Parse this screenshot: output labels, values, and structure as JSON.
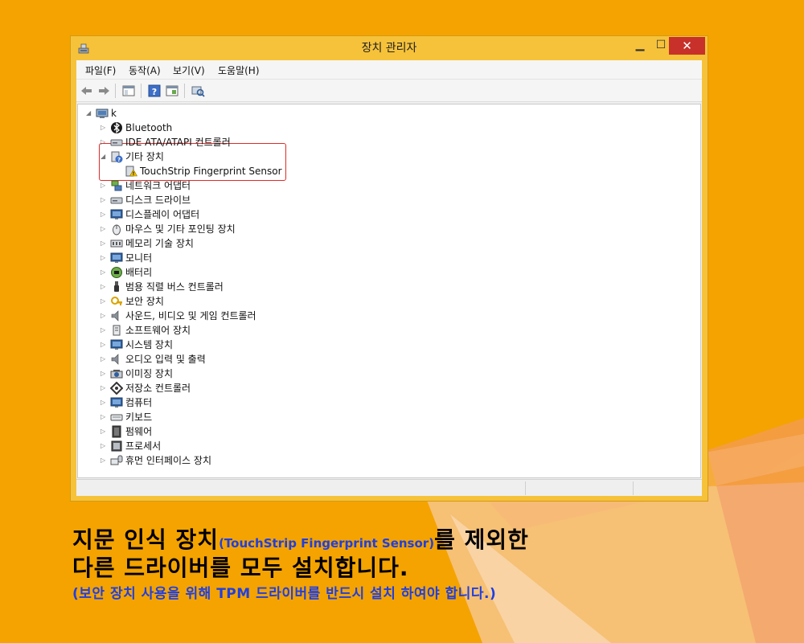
{
  "window": {
    "title": "장치 관리자",
    "controls": {
      "minimize": "▁",
      "maximize": "☐",
      "close": "✕"
    }
  },
  "menu": [
    "파일(F)",
    "동작(A)",
    "보기(V)",
    "도움말(H)"
  ],
  "toolbar": [
    "back-icon",
    "forward-icon",
    "show-hide-console-tree-icon",
    "help-icon",
    "properties-icon",
    "scan-hardware-icon"
  ],
  "tree": {
    "root": "k",
    "categories": [
      "Bluetooth",
      "IDE ATA/ATAPI 컨트롤러",
      "기타 장치",
      "네트워크 어댑터",
      "디스크 드라이브",
      "디스플레이 어댑터",
      "마우스 및 기타 포인팅 장치",
      "메모리 기술 장치",
      "모니터",
      "배터리",
      "범용 직렬 버스 컨트롤러",
      "보안 장치",
      "사운드, 비디오 및 게임 컨트롤러",
      "소프트웨어 장치",
      "시스템 장치",
      "오디오 입력 및 출력",
      "이미징 장치",
      "저장소 컨트롤러",
      "컴퓨터",
      "키보드",
      "펌웨어",
      "프로세서",
      "휴먼 인터페이스 장치"
    ],
    "other_device_child": "TouchStrip Fingerprint Sensor"
  },
  "caption": {
    "line1_a": "지문 인식 장치",
    "line1_b": "(TouchStrip Fingerprint Sensor)",
    "line1_c": "를 제외한",
    "line2": "다른 드라이버를 모두 설치합니다.",
    "line3": "(보안 장치 사용을 위해 TPM 드라이버를 반드시 설치 하여야 합니다.)"
  },
  "colors": {
    "desktop": "#f5a800",
    "highlight": "#e02a2a",
    "caption_blue": "#1f3fe0"
  }
}
